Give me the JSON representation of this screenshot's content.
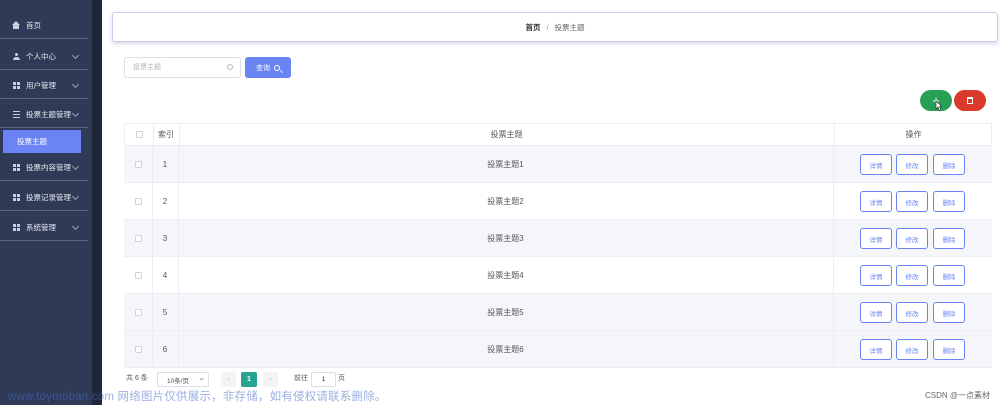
{
  "sidebar": {
    "items": [
      {
        "label": "首页",
        "icon": "home-icon"
      },
      {
        "label": "个人中心",
        "icon": "user-icon"
      },
      {
        "label": "用户管理",
        "icon": "grid-icon"
      },
      {
        "label": "投票主题管理",
        "icon": "list-icon"
      },
      {
        "label": "投票主题",
        "active": true
      },
      {
        "label": "投票内容管理",
        "icon": "grid-icon"
      },
      {
        "label": "投票记录管理",
        "icon": "grid-icon"
      },
      {
        "label": "系统管理",
        "icon": "grid-icon"
      }
    ]
  },
  "breadcrumb": {
    "home": "首页",
    "separator": "/",
    "current": "投票主题"
  },
  "search": {
    "placeholder": "投票主题",
    "value": "",
    "button_label": "查询"
  },
  "actions": {
    "add_label": "+"
  },
  "table": {
    "headers": {
      "index": "索引",
      "topic": "投票主题",
      "ops": "操作"
    },
    "rows": [
      {
        "index": "1",
        "topic": "投票主题1"
      },
      {
        "index": "2",
        "topic": "投票主题2"
      },
      {
        "index": "3",
        "topic": "投票主题3"
      },
      {
        "index": "4",
        "topic": "投票主题4"
      },
      {
        "index": "5",
        "topic": "投票主题5"
      },
      {
        "index": "6",
        "topic": "投票主题6"
      }
    ],
    "row_buttons": {
      "detail": "详情",
      "edit": "修改",
      "delete": "删除"
    }
  },
  "pagination": {
    "total_text": "共 6 条",
    "page_size": "10条/页",
    "prev": "‹",
    "current_page": "1",
    "next": "›",
    "goto_label": "前往",
    "goto_value": "1",
    "page_unit": "页"
  },
  "overlay": {
    "watermark": "www.toymoban.com 网络图片仅供展示，非存储，如有侵权请联系删除。",
    "credit": "CSDN @一点素材"
  },
  "colors": {
    "primary": "#6a84f5",
    "success": "#27a055",
    "danger": "#d93a2b",
    "sidebar": "#2f3a56",
    "pager_active": "#27a48f"
  }
}
